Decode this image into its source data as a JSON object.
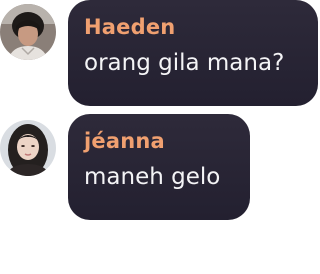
{
  "messages": [
    {
      "author": "Haeden",
      "text": "orang gila mana?",
      "name_color": "#f0a070",
      "avatar": "avatar-photo-man"
    },
    {
      "author": "jéanna",
      "text": "maneh gelo",
      "name_color": "#f0a070",
      "avatar": "avatar-photo-woman"
    }
  ],
  "colors": {
    "bubble_bg": "#2a2636",
    "message_text": "#f4f4f6",
    "page_bg": "#ffffff"
  }
}
